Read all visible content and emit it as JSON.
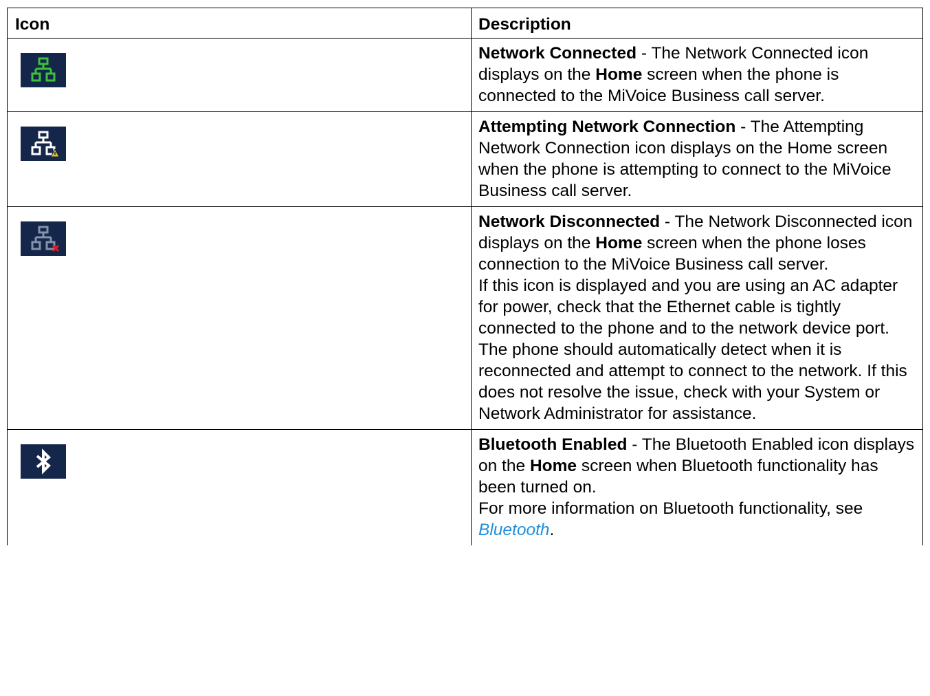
{
  "table": {
    "headers": [
      "Icon",
      "Description"
    ],
    "rows": [
      {
        "icon": "network-connected-icon",
        "title": "Network Connected",
        "sep": " - ",
        "t1": "The Network Connected icon displays on the ",
        "home": "Home",
        "t2": " screen when the phone is connected to the MiVoice Business call server."
      },
      {
        "icon": "attempting-network-connection-icon",
        "title": "Attempting Network Connection",
        "sep": " - ",
        "t1": "The Attempting Network Connection icon displays on the Home screen when the phone is attempting to connect to the MiVoice Business call server."
      },
      {
        "icon": "network-disconnected-icon",
        "title": "Network Disconnected",
        "sep": " - ",
        "t1": "The Network Disconnected icon displays on the ",
        "home": "Home",
        "t2": " screen when the phone loses connection to the MiVoice Business call server.",
        "p2": "If this icon is displayed and you are using an AC adapter for power, check that the Ethernet cable is tightly connected to the phone and to the network device port. The phone should automatically detect when it is reconnected and attempt to connect to the network. If this does not resolve the issue, check with your System or Network Administrator for assistance."
      },
      {
        "icon": "bluetooth-enabled-icon",
        "title": "Bluetooth Enabled",
        "sep": " - ",
        "t1": "The Bluetooth Enabled icon displays on the ",
        "home": "Home",
        "t2": " screen when Bluetooth functionality has been turned on.",
        "p2a": "For more information on Bluetooth functionality, see ",
        "link": "Bluetooth",
        "p2b": "."
      }
    ]
  },
  "colors": {
    "icon_bg": "#14264a",
    "connected": "#3cc23c",
    "attempting": "#ffffff",
    "warning": "#e8c21a",
    "disconnected": "#8592ab",
    "error": "#e02020",
    "link": "#1e8fdc"
  }
}
